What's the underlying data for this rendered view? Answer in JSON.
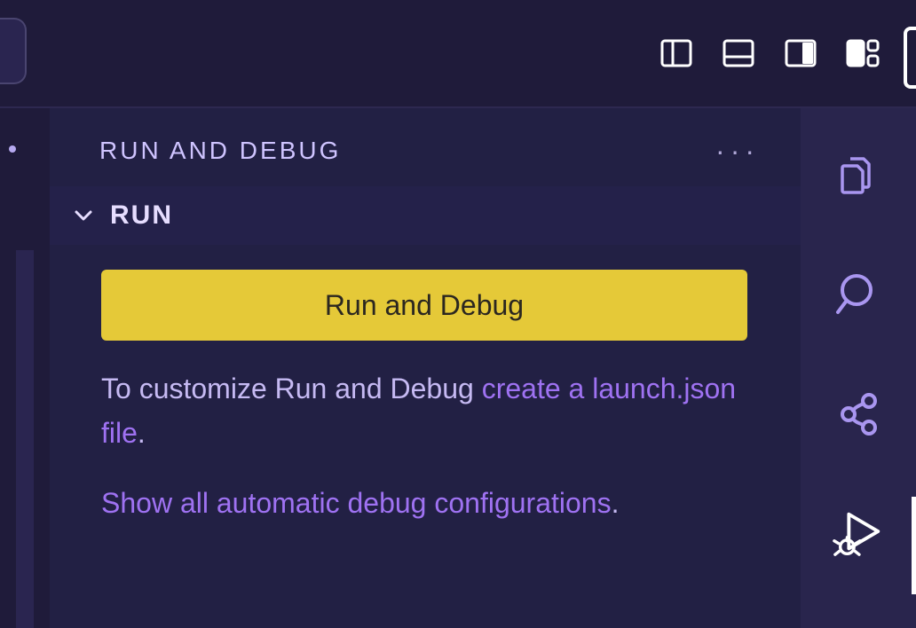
{
  "panel": {
    "title": "RUN AND DEBUG",
    "section_title": "RUN",
    "run_button": "Run and Debug",
    "customize_prefix": "To customize Run and Debug ",
    "customize_link": "create a launch.json file",
    "show_all_link": "Show all automatic debug configurations",
    "period": "."
  },
  "titlebar_icons": [
    "toggle-primary-sidebar",
    "toggle-panel",
    "toggle-secondary-sidebar",
    "customize-layout"
  ],
  "activity_bar": {
    "items": [
      "explorer",
      "search",
      "source-control",
      "run-debug"
    ],
    "active": "run-debug"
  },
  "colors": {
    "bg": "#1f1b3a",
    "panel": "#222044",
    "activity": "#29254d",
    "accent_button": "#e5c938",
    "link": "#9f72f2",
    "text": "#c6baf3",
    "icon_inactive": "#a996f0",
    "icon_active": "#ffffff"
  }
}
